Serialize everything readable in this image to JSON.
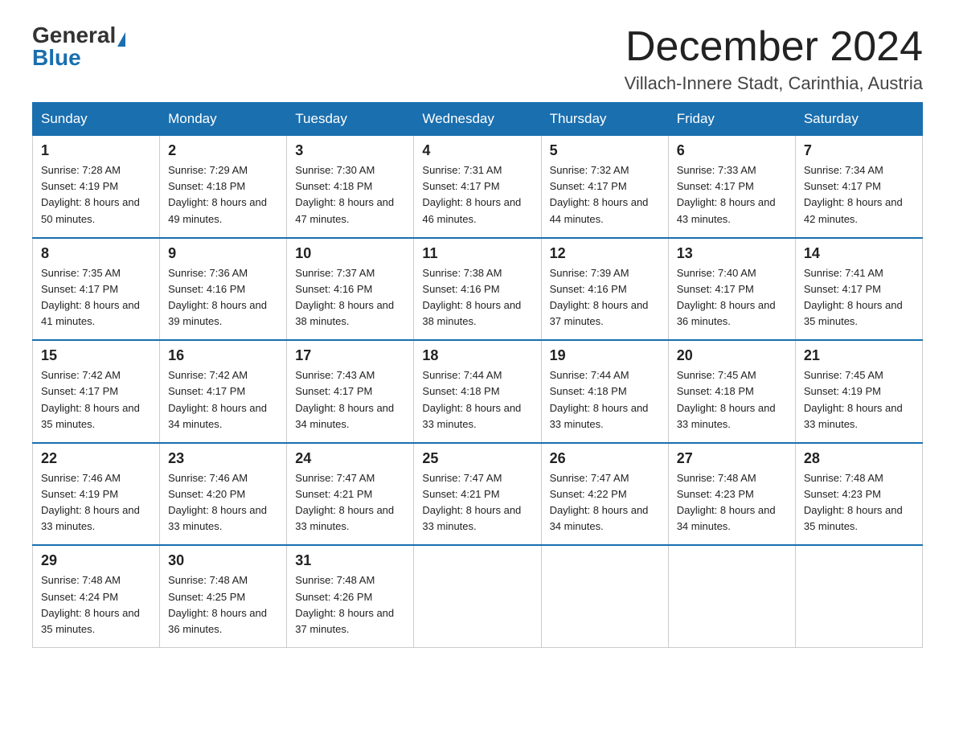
{
  "logo": {
    "general": "General",
    "blue": "Blue"
  },
  "title": "December 2024",
  "location": "Villach-Innere Stadt, Carinthia, Austria",
  "days_of_week": [
    "Sunday",
    "Monday",
    "Tuesday",
    "Wednesday",
    "Thursday",
    "Friday",
    "Saturday"
  ],
  "weeks": [
    [
      {
        "num": "1",
        "sunrise": "7:28 AM",
        "sunset": "4:19 PM",
        "daylight": "8 hours and 50 minutes."
      },
      {
        "num": "2",
        "sunrise": "7:29 AM",
        "sunset": "4:18 PM",
        "daylight": "8 hours and 49 minutes."
      },
      {
        "num": "3",
        "sunrise": "7:30 AM",
        "sunset": "4:18 PM",
        "daylight": "8 hours and 47 minutes."
      },
      {
        "num": "4",
        "sunrise": "7:31 AM",
        "sunset": "4:17 PM",
        "daylight": "8 hours and 46 minutes."
      },
      {
        "num": "5",
        "sunrise": "7:32 AM",
        "sunset": "4:17 PM",
        "daylight": "8 hours and 44 minutes."
      },
      {
        "num": "6",
        "sunrise": "7:33 AM",
        "sunset": "4:17 PM",
        "daylight": "8 hours and 43 minutes."
      },
      {
        "num": "7",
        "sunrise": "7:34 AM",
        "sunset": "4:17 PM",
        "daylight": "8 hours and 42 minutes."
      }
    ],
    [
      {
        "num": "8",
        "sunrise": "7:35 AM",
        "sunset": "4:17 PM",
        "daylight": "8 hours and 41 minutes."
      },
      {
        "num": "9",
        "sunrise": "7:36 AM",
        "sunset": "4:16 PM",
        "daylight": "8 hours and 39 minutes."
      },
      {
        "num": "10",
        "sunrise": "7:37 AM",
        "sunset": "4:16 PM",
        "daylight": "8 hours and 38 minutes."
      },
      {
        "num": "11",
        "sunrise": "7:38 AM",
        "sunset": "4:16 PM",
        "daylight": "8 hours and 38 minutes."
      },
      {
        "num": "12",
        "sunrise": "7:39 AM",
        "sunset": "4:16 PM",
        "daylight": "8 hours and 37 minutes."
      },
      {
        "num": "13",
        "sunrise": "7:40 AM",
        "sunset": "4:17 PM",
        "daylight": "8 hours and 36 minutes."
      },
      {
        "num": "14",
        "sunrise": "7:41 AM",
        "sunset": "4:17 PM",
        "daylight": "8 hours and 35 minutes."
      }
    ],
    [
      {
        "num": "15",
        "sunrise": "7:42 AM",
        "sunset": "4:17 PM",
        "daylight": "8 hours and 35 minutes."
      },
      {
        "num": "16",
        "sunrise": "7:42 AM",
        "sunset": "4:17 PM",
        "daylight": "8 hours and 34 minutes."
      },
      {
        "num": "17",
        "sunrise": "7:43 AM",
        "sunset": "4:17 PM",
        "daylight": "8 hours and 34 minutes."
      },
      {
        "num": "18",
        "sunrise": "7:44 AM",
        "sunset": "4:18 PM",
        "daylight": "8 hours and 33 minutes."
      },
      {
        "num": "19",
        "sunrise": "7:44 AM",
        "sunset": "4:18 PM",
        "daylight": "8 hours and 33 minutes."
      },
      {
        "num": "20",
        "sunrise": "7:45 AM",
        "sunset": "4:18 PM",
        "daylight": "8 hours and 33 minutes."
      },
      {
        "num": "21",
        "sunrise": "7:45 AM",
        "sunset": "4:19 PM",
        "daylight": "8 hours and 33 minutes."
      }
    ],
    [
      {
        "num": "22",
        "sunrise": "7:46 AM",
        "sunset": "4:19 PM",
        "daylight": "8 hours and 33 minutes."
      },
      {
        "num": "23",
        "sunrise": "7:46 AM",
        "sunset": "4:20 PM",
        "daylight": "8 hours and 33 minutes."
      },
      {
        "num": "24",
        "sunrise": "7:47 AM",
        "sunset": "4:21 PM",
        "daylight": "8 hours and 33 minutes."
      },
      {
        "num": "25",
        "sunrise": "7:47 AM",
        "sunset": "4:21 PM",
        "daylight": "8 hours and 33 minutes."
      },
      {
        "num": "26",
        "sunrise": "7:47 AM",
        "sunset": "4:22 PM",
        "daylight": "8 hours and 34 minutes."
      },
      {
        "num": "27",
        "sunrise": "7:48 AM",
        "sunset": "4:23 PM",
        "daylight": "8 hours and 34 minutes."
      },
      {
        "num": "28",
        "sunrise": "7:48 AM",
        "sunset": "4:23 PM",
        "daylight": "8 hours and 35 minutes."
      }
    ],
    [
      {
        "num": "29",
        "sunrise": "7:48 AM",
        "sunset": "4:24 PM",
        "daylight": "8 hours and 35 minutes."
      },
      {
        "num": "30",
        "sunrise": "7:48 AM",
        "sunset": "4:25 PM",
        "daylight": "8 hours and 36 minutes."
      },
      {
        "num": "31",
        "sunrise": "7:48 AM",
        "sunset": "4:26 PM",
        "daylight": "8 hours and 37 minutes."
      },
      null,
      null,
      null,
      null
    ]
  ]
}
